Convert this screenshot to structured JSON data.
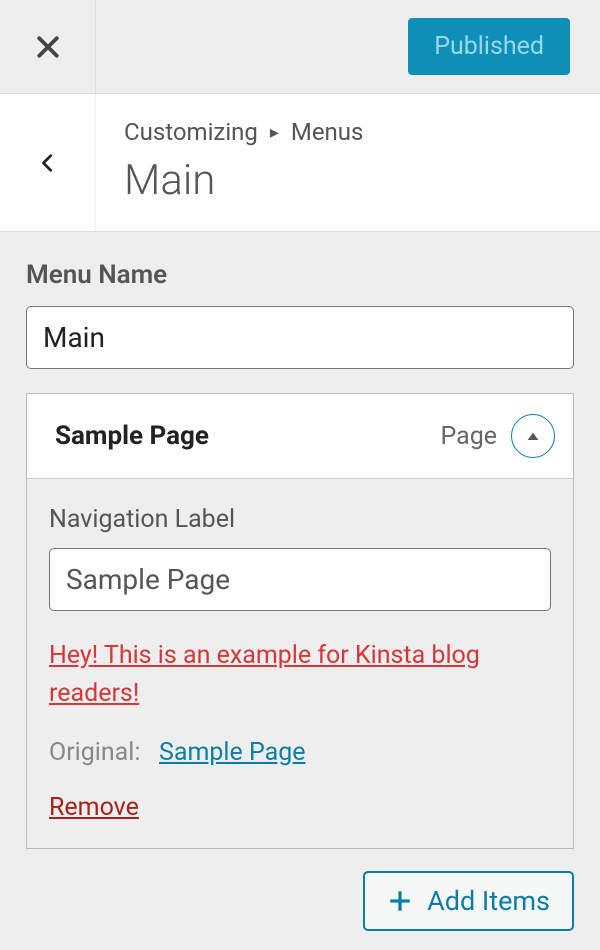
{
  "topbar": {
    "publish_label": "Published"
  },
  "breadcrumb": {
    "root": "Customizing",
    "section": "Menus",
    "title": "Main"
  },
  "menu_name": {
    "label": "Menu Name",
    "value": "Main"
  },
  "menu_item": {
    "title": "Sample Page",
    "type": "Page",
    "nav_label_heading": "Navigation Label",
    "nav_label_value": "Sample Page",
    "description_text": "Hey! This is an example for Kinsta blog readers!",
    "original_prefix": "Original:",
    "original_link": "Sample Page",
    "remove_label": "Remove"
  },
  "add_items_label": "Add Items"
}
